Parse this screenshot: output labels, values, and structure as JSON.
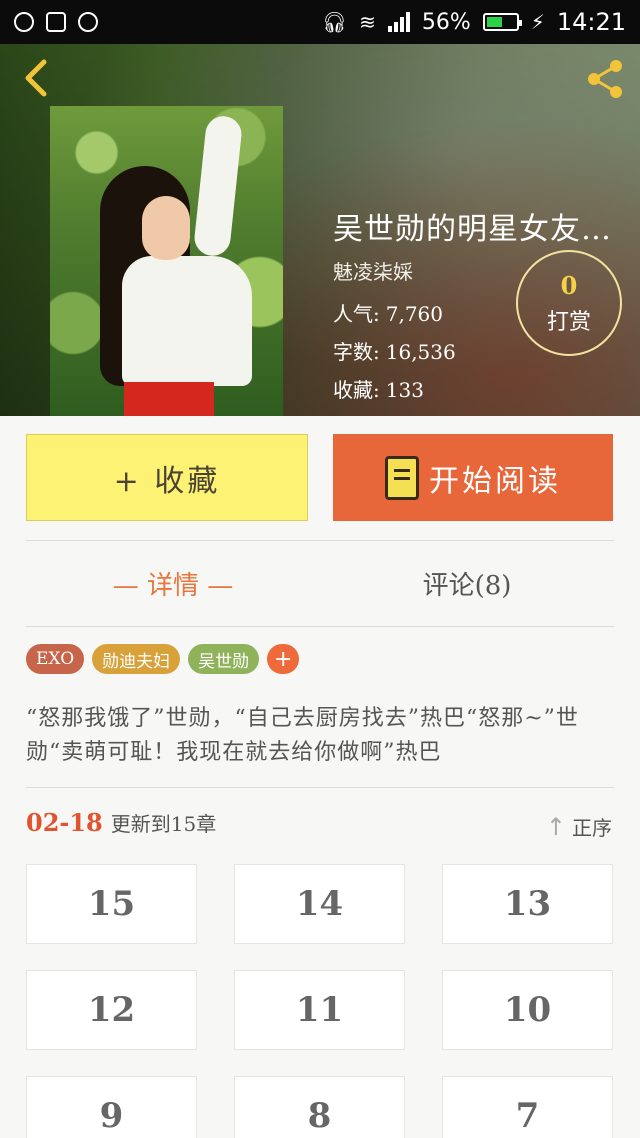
{
  "status_bar": {
    "battery": "56%",
    "time": "14:21"
  },
  "book": {
    "title": "吴世勋的明星女友…",
    "author": "魅凌柒婇",
    "stats": [
      {
        "key": "人气:",
        "value": "7,760"
      },
      {
        "key": "字数:",
        "value": "16,536"
      },
      {
        "key": "收藏:",
        "value": "133"
      }
    ],
    "reward": {
      "count": "0",
      "label": "打赏"
    }
  },
  "actions": {
    "favorite": "+ 收藏",
    "read": "开始阅读"
  },
  "tabs": {
    "detail": "— 详情 —",
    "comments": "评论(8)"
  },
  "tags": [
    "EXO",
    "勋迪夫妇",
    "吴世勋"
  ],
  "description": "“怒那我饿了”世勋，“自己去厨房找去”热巴“怒那~”世勋“卖萌可耻！我现在就去给你做啊”热巴",
  "update": {
    "date": "02-18",
    "text": "更新到15章",
    "sort": "正序"
  },
  "chapters": [
    "15",
    "14",
    "13",
    "12",
    "11",
    "10",
    "9",
    "8",
    "7"
  ],
  "colors": {
    "accent": "#e8673a",
    "favorite_bg": "#fdf274",
    "reward_text": "#f5d24a"
  }
}
